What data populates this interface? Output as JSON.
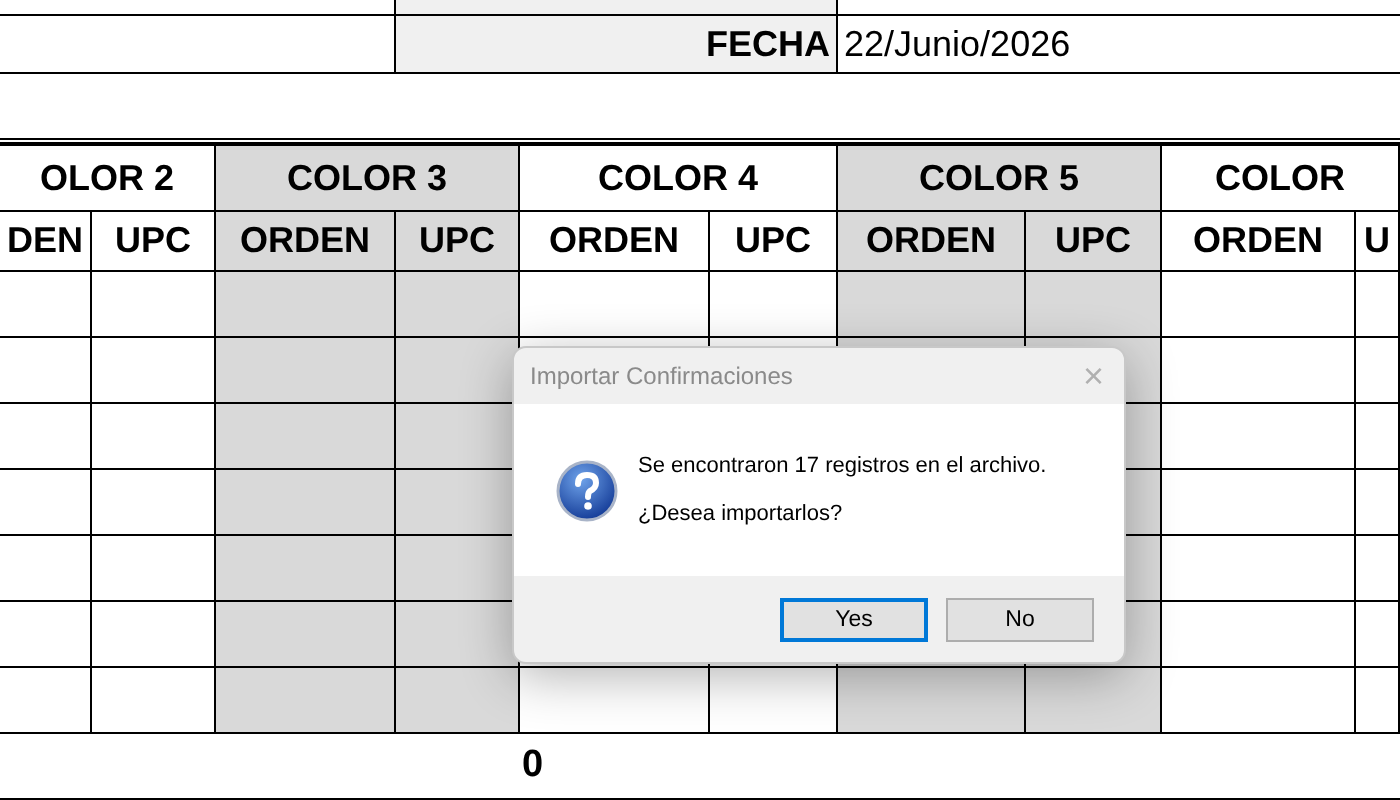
{
  "date_row": {
    "label": "FECHA",
    "value": "22/Junio/2026"
  },
  "color_groups": [
    {
      "label": "OLOR 2",
      "shaded": false,
      "columns": [
        "DEN",
        "UPC"
      ]
    },
    {
      "label": "COLOR 3",
      "shaded": true,
      "columns": [
        "ORDEN",
        "UPC"
      ]
    },
    {
      "label": "COLOR 4",
      "shaded": false,
      "columns": [
        "ORDEN",
        "UPC"
      ]
    },
    {
      "label": "COLOR 5",
      "shaded": true,
      "columns": [
        "ORDEN",
        "UPC"
      ]
    },
    {
      "label": "COLOR",
      "shaded": false,
      "columns": [
        "ORDEN",
        "U"
      ]
    }
  ],
  "total": "0",
  "dialog": {
    "title": "Importar Confirmaciones",
    "close": "×",
    "message": "Se encontraron 17 registros en el archivo.",
    "question": "¿Desea importarlos?",
    "buttons": [
      {
        "label": "Yes",
        "kind": "default"
      },
      {
        "label": "No",
        "kind": "normal"
      }
    ]
  }
}
